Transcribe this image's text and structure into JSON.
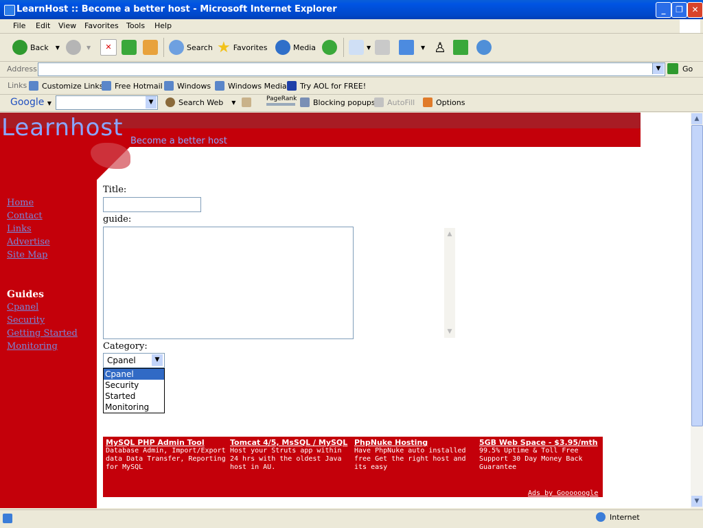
{
  "window": {
    "title": "LearnHost :: Become a better host - Microsoft Internet Explorer"
  },
  "menu": [
    "File",
    "Edit",
    "View",
    "Favorites",
    "Tools",
    "Help"
  ],
  "toolbar": {
    "back": "Back",
    "search": "Search",
    "favorites": "Favorites",
    "media": "Media"
  },
  "address": {
    "label": "Address",
    "value": "",
    "go": "Go"
  },
  "links": {
    "label": "Links",
    "items": [
      "Customize Links",
      "Free Hotmail",
      "Windows",
      "Windows Media",
      "Try AOL for FREE!"
    ]
  },
  "google": {
    "logo": "Google",
    "search_web": "Search Web",
    "pagerank": "PageRank",
    "blocking": "Blocking popups",
    "autofill": "AutoFill",
    "options": "Options"
  },
  "site": {
    "logo": "Learnhost",
    "tagline": "Become a better host"
  },
  "nav": [
    "Home",
    "Contact",
    "Links",
    "Advertise",
    "Site Map"
  ],
  "guides": {
    "heading": "Guides",
    "items": [
      "Cpanel",
      "Security",
      "Getting Started",
      "Monitoring"
    ]
  },
  "form": {
    "title_label": "Title:",
    "title_value": "",
    "guide_label": "guide:",
    "category_label": "Category:",
    "category_selected": "Cpanel",
    "category_options": [
      "Cpanel",
      "Security",
      "Started",
      "Monitoring"
    ]
  },
  "ads": [
    {
      "title": "MySQL PHP Admin Tool",
      "body": "Database Admin, Import/Export data Data Transfer, Reporting for MySQL"
    },
    {
      "title": "Tomcat 4/5, MsSQL / MySQL",
      "body": "Host your Struts app within 24 hrs with the oldest Java host in AU."
    },
    {
      "title": "PhpNuke Hosting",
      "body": "Have PhpNuke auto installed free Get the right host and its easy"
    },
    {
      "title": "5GB Web Space - $3.95/mth",
      "body": "99.5% Uptime & Toll Free Support 30 Day Money Back Guarantee"
    }
  ],
  "ads_by": "Ads by Goooooogle",
  "status": {
    "zone": "Internet"
  }
}
